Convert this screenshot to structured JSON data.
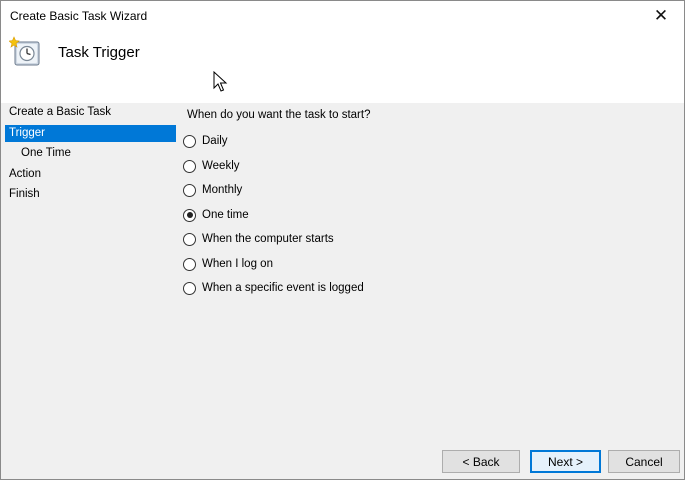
{
  "window": {
    "title": "Create Basic Task Wizard",
    "close_glyph": "✕"
  },
  "header": {
    "title": "Task Trigger",
    "icon": "clock-wizard-icon"
  },
  "sidebar": {
    "items": [
      {
        "label": "Create a Basic Task"
      },
      {
        "label": "Trigger"
      },
      {
        "label": "One Time"
      },
      {
        "label": "Action"
      },
      {
        "label": "Finish"
      }
    ],
    "selected": "Trigger"
  },
  "main": {
    "prompt": "When do you want the task to start?",
    "options": [
      {
        "label": "Daily"
      },
      {
        "label": "Weekly"
      },
      {
        "label": "Monthly"
      },
      {
        "label": "One time"
      },
      {
        "label": "When the computer starts"
      },
      {
        "label": "When I log on"
      },
      {
        "label": "When a specific event is logged"
      }
    ],
    "selected": "One time"
  },
  "buttons": {
    "back": "< Back",
    "next": "Next >",
    "cancel": "Cancel"
  },
  "colors": {
    "accent": "#0078d7",
    "background": "#f0f0f0",
    "header": "#ffffff"
  }
}
